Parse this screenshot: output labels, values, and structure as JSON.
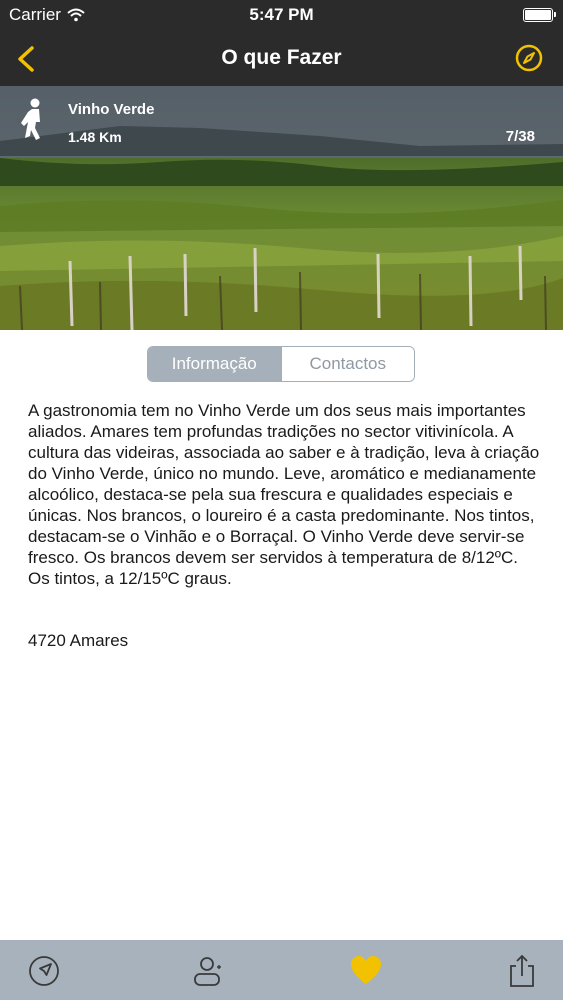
{
  "status_bar": {
    "carrier": "Carrier",
    "time": "5:47 PM",
    "wifi_icon": "wifi-icon",
    "battery_icon": "battery-icon"
  },
  "nav": {
    "title": "O que Fazer",
    "back_icon": "chevron-left-icon",
    "right_icon": "compass-icon",
    "accent_color": "#f2c200"
  },
  "hero": {
    "activity_icon": "walking-person-icon",
    "name": "Vinho Verde",
    "distance": "1.48 Km",
    "counter": "7/38",
    "image_subject": "vineyard"
  },
  "segments": {
    "active": "Informação",
    "inactive": "Contactos"
  },
  "content": {
    "description": "A gastronomia tem no Vinho Verde um dos seus mais importantes aliados. Amares tem profundas tradições no sector vitivinícola. A cultura das videiras, associada ao saber e à tradição, leva à criação do Vinho Verde, único no mundo. Leve, aromático e medianamente alcoólico, destaca-se pela sua frescura e qualidades especiais e únicas. Nos brancos, o loureiro é a casta predominante. Nos tintos, destacam-se o Vinhão e o Borraçal. O Vinho Verde deve servir-se fresco. Os brancos devem ser servidos à temperatura de 8/12ºC. Os tintos, a 12/15ºC graus.",
    "address": "4720 Amares"
  },
  "tabbar": {
    "icons": [
      "navigation-arrow-icon",
      "add-contact-icon",
      "heart-icon",
      "share-icon"
    ],
    "favorite_color": "#f2c200"
  }
}
